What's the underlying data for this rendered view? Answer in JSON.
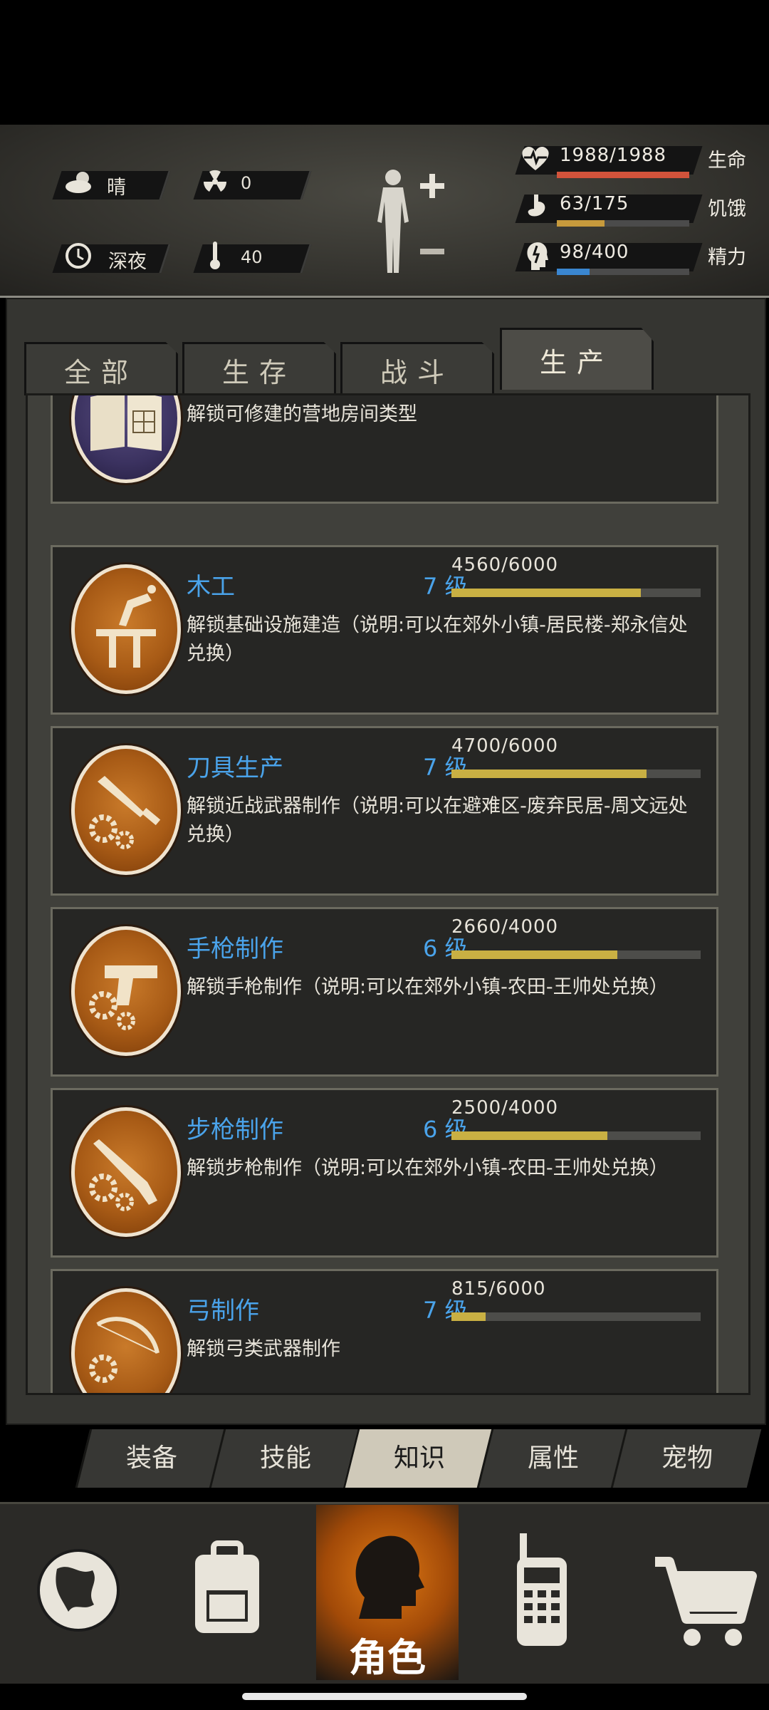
{
  "status": {
    "weather": "晴",
    "radiation": "0",
    "time_of_day": "深夜",
    "temperature": "40",
    "health": {
      "value": "1988/1988",
      "label": "生命",
      "fraction": 1.0,
      "color": "#d2533b"
    },
    "hunger": {
      "value": "63/175",
      "label": "饥饿",
      "fraction": 0.36,
      "color": "#c79a3c"
    },
    "energy": {
      "value": "98/400",
      "label": "精力",
      "fraction": 0.245,
      "color": "#3a86d0"
    }
  },
  "tabs": [
    {
      "label": "全部"
    },
    {
      "label": "生存"
    },
    {
      "label": "战斗"
    },
    {
      "label": "生产"
    }
  ],
  "skills": [
    {
      "name": "",
      "level": "",
      "xp": "",
      "progress": null,
      "desc": "解锁可修建的营地房间类型",
      "icon": "book-blueprint-icon"
    },
    {
      "name": "木工",
      "level": "7 级",
      "xp": "4560/6000",
      "progress": 0.76,
      "desc": "解锁基础设施建造（说明:可以在郊外小镇-居民楼-郑永信处兑换）",
      "icon": "carpentry-icon"
    },
    {
      "name": "刀具生产",
      "level": "7 级",
      "xp": "4700/6000",
      "progress": 0.783,
      "desc": "解锁近战武器制作（说明:可以在避难区-废弃民居-周文远处兑换）",
      "icon": "knife-gear-icon"
    },
    {
      "name": "手枪制作",
      "level": "6 级",
      "xp": "2660/4000",
      "progress": 0.665,
      "desc": "解锁手枪制作（说明:可以在郊外小镇-农田-王帅处兑换）",
      "icon": "pistol-gear-icon"
    },
    {
      "name": "步枪制作",
      "level": "6 级",
      "xp": "2500/4000",
      "progress": 0.625,
      "desc": "解锁步枪制作（说明:可以在郊外小镇-农田-王帅处兑换）",
      "icon": "rifle-gear-icon"
    },
    {
      "name": "弓制作",
      "level": "7 级",
      "xp": "815/6000",
      "progress": 0.136,
      "desc": "解锁弓类武器制作",
      "icon": "bow-gear-icon"
    }
  ],
  "subnav": [
    {
      "label": "装备"
    },
    {
      "label": "技能"
    },
    {
      "label": "知识"
    },
    {
      "label": "属性"
    },
    {
      "label": "宠物"
    }
  ],
  "bottomnav": {
    "character_label": "角色"
  }
}
